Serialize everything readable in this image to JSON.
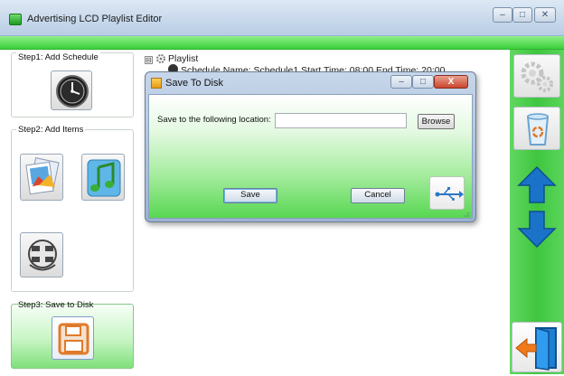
{
  "window": {
    "title": "Advertising LCD Playlist Editor",
    "min_glyph": "–",
    "max_glyph": "□",
    "close_glyph": "✕"
  },
  "steps": {
    "step1_label": "Step1: Add Schedule",
    "step2_label": "Step2: Add Items",
    "step3_label": "Step3: Save to Disk"
  },
  "tree": {
    "root_label": "Playlist",
    "root_expander": "⊟",
    "child_label": "Schedule Name: Schedule1   Start Time: 08:00   End Time: 20:00"
  },
  "dialog": {
    "title": "Save To Disk",
    "location_label": "Save  to the following location:",
    "location_value": "",
    "browse_label": "Browse",
    "save_label": "Save",
    "cancel_label": "Cancel",
    "min_glyph": "–",
    "max_glyph": "□",
    "close_glyph": "X"
  },
  "icons": {
    "clock": "clock-icon",
    "image": "image-icon",
    "music": "music-icon",
    "video": "video-reel-icon",
    "save": "floppy-disk-icon",
    "settings": "gears-icon",
    "trash": "recycle-bin-icon",
    "up": "arrow-up-icon",
    "down": "arrow-down-icon",
    "exit": "exit-door-icon",
    "usb": "usb-icon"
  },
  "colors": {
    "accent_green": "#3bcf3b",
    "arrow_blue": "#1a73c9",
    "save_orange": "#e07a2a"
  }
}
